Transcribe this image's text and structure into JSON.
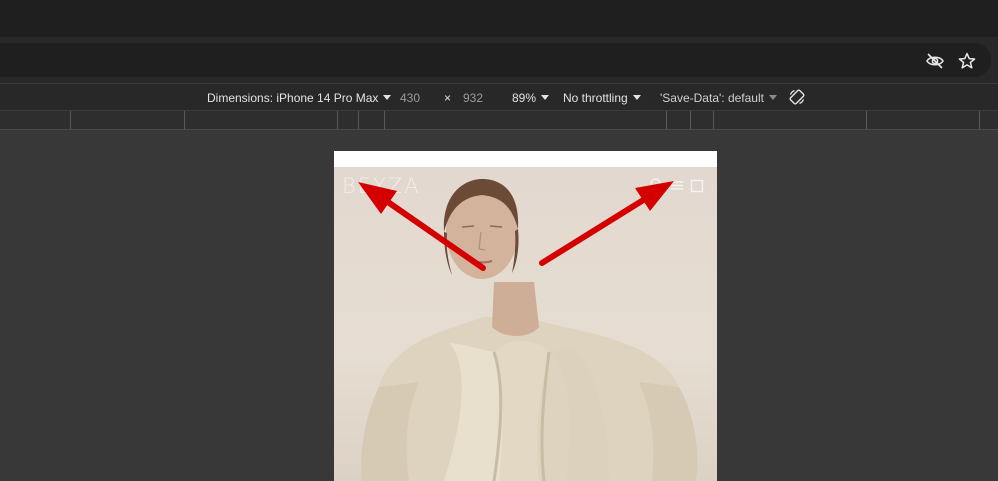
{
  "browser": {
    "icons": [
      "eye-off-icon",
      "star-icon"
    ]
  },
  "device_toolbar": {
    "dimensions_label": "Dimensions: iPhone 14 Pro Max",
    "width": "430",
    "times": "×",
    "height": "932",
    "zoom": "89%",
    "throttling": "No throttling",
    "save_data": "'Save-Data': default",
    "rotate_icon": "rotate-icon"
  },
  "page": {
    "brand": "BEYZA",
    "nav_icons": [
      "search-icon",
      "menu-icon",
      "bag-icon"
    ]
  },
  "annotation": {
    "arrow_color": "#d40000"
  }
}
